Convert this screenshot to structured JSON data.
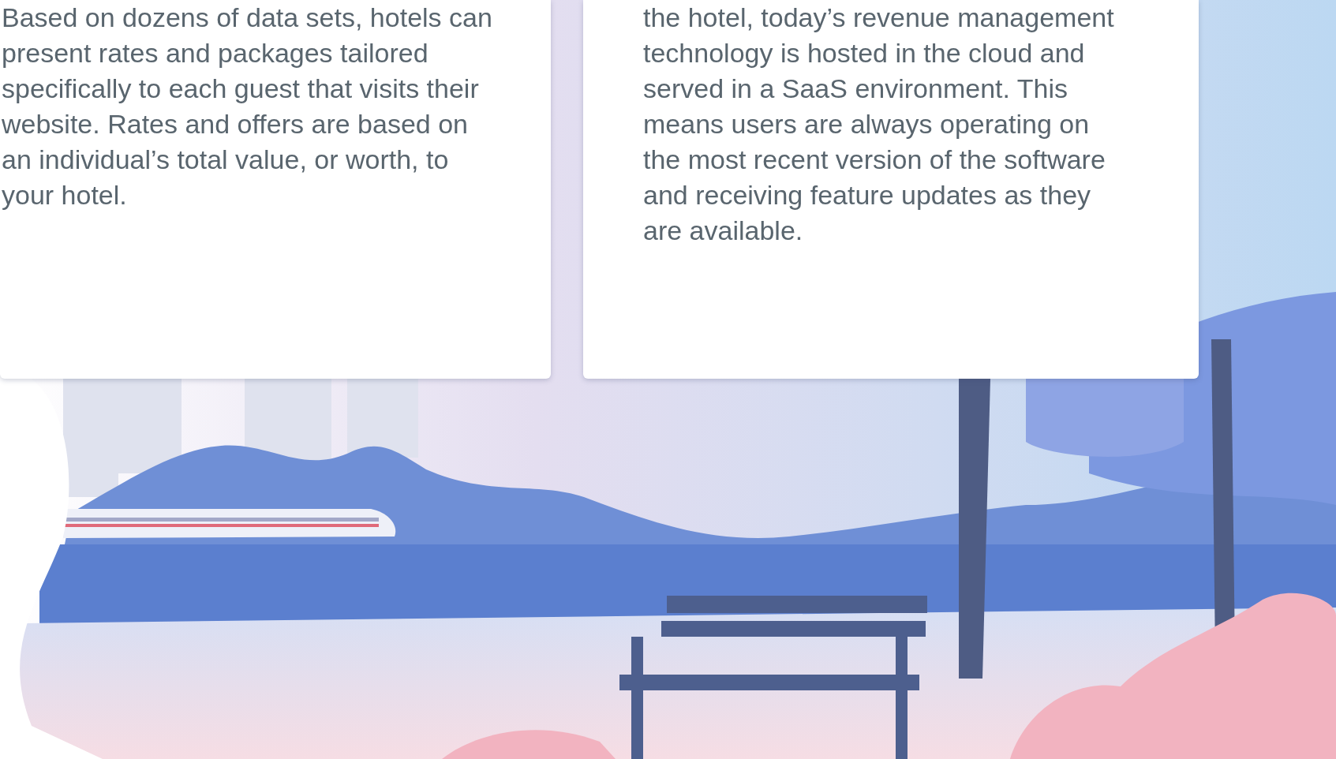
{
  "cards": [
    {
      "text": "Based on dozens of data sets, hotels can present rates and packages tailored specifically to each guest that visits their website. Rates and offers are based on an individual’s total value, or worth, to your hotel."
    },
    {
      "text": "the hotel, today’s revenue management technology is hosted in the cloud and served in a SaaS environment. This means users are always operating on the most recent version of the software and receiving feature updates as they are available."
    }
  ]
}
